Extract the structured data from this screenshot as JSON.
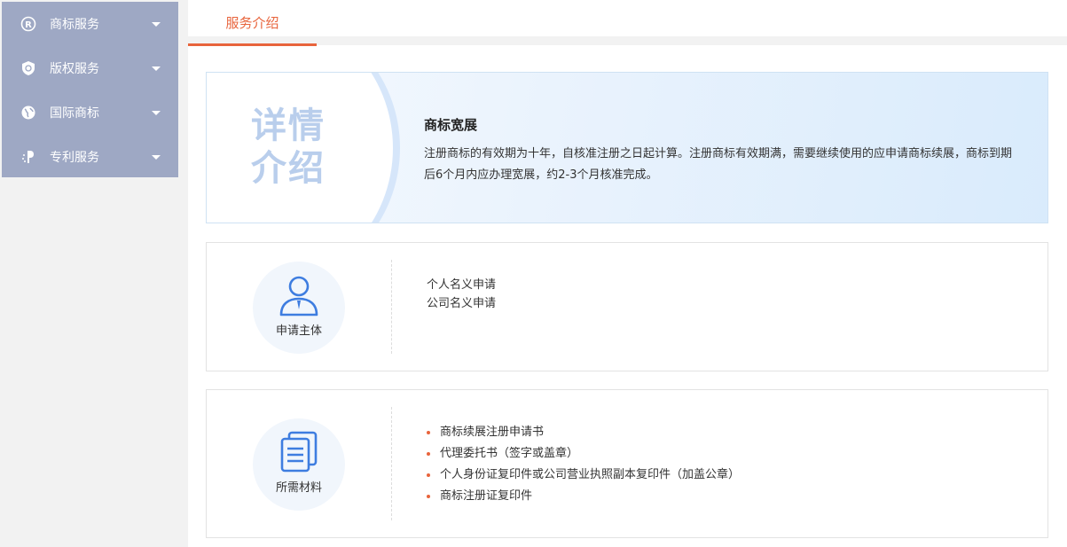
{
  "sidebar": {
    "items": [
      {
        "label": "商标服务",
        "icon": "registered-icon"
      },
      {
        "label": "版权服务",
        "icon": "shield-icon"
      },
      {
        "label": "国际商标",
        "icon": "globe-icon"
      },
      {
        "label": "专利服务",
        "icon": "patent-icon"
      }
    ]
  },
  "tabs": [
    {
      "label": "服务介绍"
    }
  ],
  "banner": {
    "big_text_line1": "详情",
    "big_text_line2": "介绍",
    "title": "商标宽展",
    "description": "注册商标的有效期为十年，自核准注册之日起计算。注册商标有效期满，需要继续使用的应申请商标续展，商标到期后6个月内应办理宽展，约2-3个月核准完成。"
  },
  "applicant": {
    "caption": "申请主体",
    "lines": [
      "个人名义申请",
      "公司名义申请"
    ]
  },
  "materials": {
    "caption": "所需材料",
    "items": [
      "商标续展注册申请书",
      "代理委托书（签字或盖章）",
      "个人身份证复印件或公司营业执照副本复印件（加盖公章）",
      "商标注册证复印件"
    ]
  },
  "colors": {
    "accent": "#e8643c",
    "sidebar_bg": "#9ea8c4",
    "icon_blue": "#3e7de0"
  }
}
